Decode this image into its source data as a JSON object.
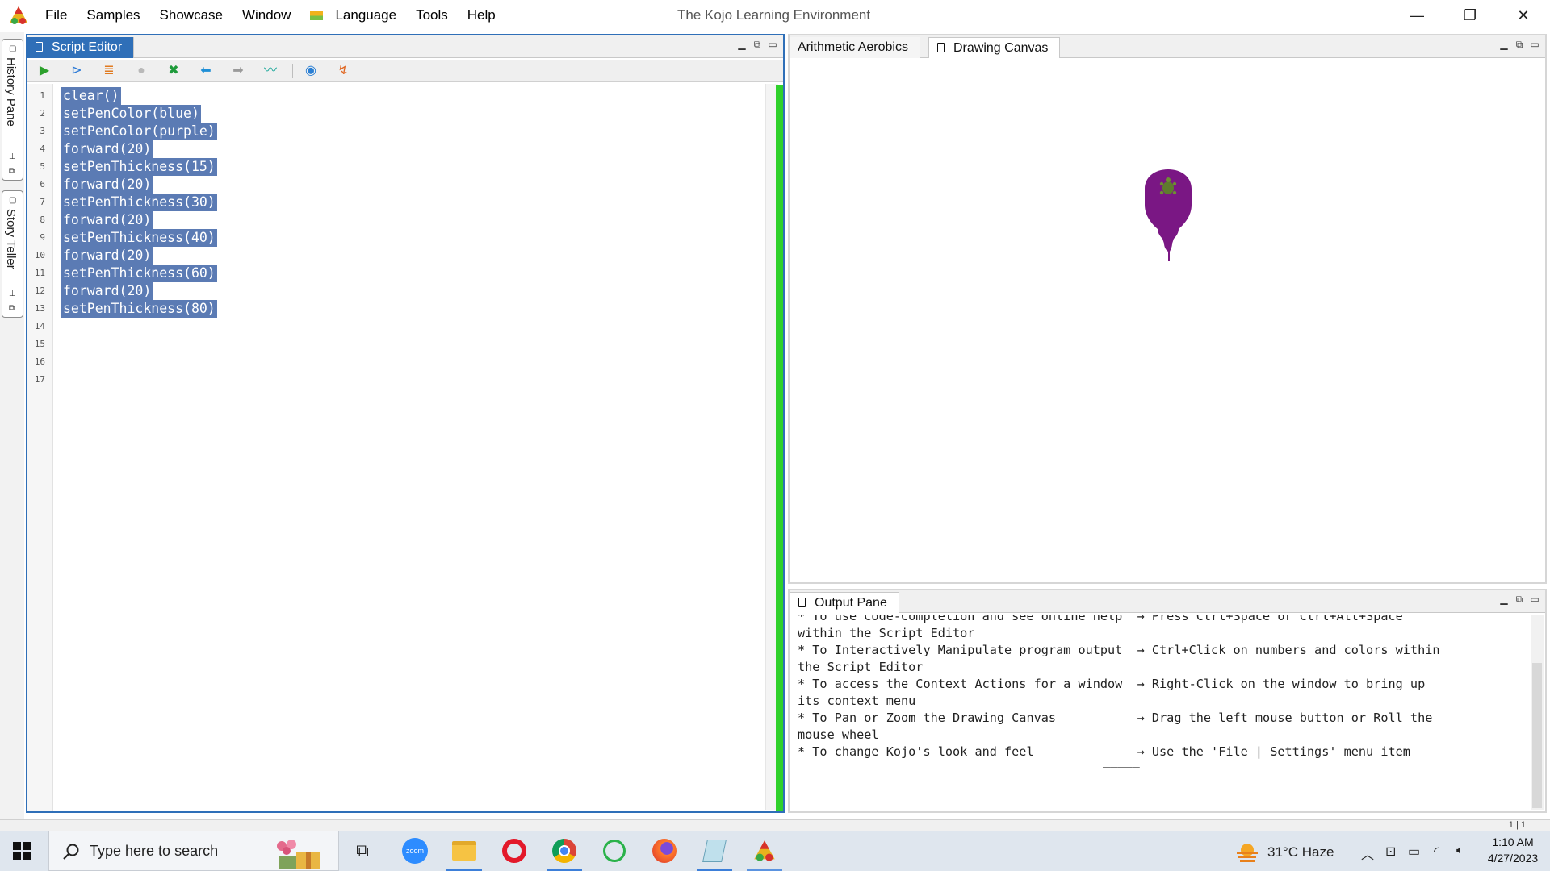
{
  "titlebar": {
    "app_title": "The Kojo Learning Environment",
    "menu": [
      "File",
      "Samples",
      "Showcase",
      "Window",
      "Language",
      "Tools",
      "Help"
    ],
    "controls": {
      "minimize": "—",
      "restore": "❐",
      "close": "✕"
    }
  },
  "side_tabs": [
    {
      "label": "History Pane"
    },
    {
      "label": "Story Teller"
    }
  ],
  "script_editor": {
    "tab_label": "Script Editor",
    "toolbar_icons": [
      "run-icon",
      "step-icon",
      "trace-icon",
      "stop-icon",
      "clear-icon",
      "undo-icon",
      "redo-icon",
      "format-icon",
      "help-icon",
      "reset-icon"
    ],
    "line_numbers": [
      "1",
      "2",
      "3",
      "4",
      "5",
      "6",
      "7",
      "8",
      "9",
      "10",
      "11",
      "12",
      "13",
      "14",
      "15",
      "16",
      "17"
    ],
    "code_lines": [
      "clear()",
      "setPenColor(blue)",
      "setPenColor(purple)",
      "forward(20)",
      "setPenThickness(15)",
      "forward(20)",
      "setPenThickness(30)",
      "forward(20)",
      "setPenThickness(40)",
      "forward(20)",
      "setPenThickness(60)",
      "forward(20)",
      "setPenThickness(80)"
    ],
    "selection_color": "#5b7bb4"
  },
  "canvas": {
    "tabs": [
      "Arithmetic Aerobics",
      "Drawing Canvas"
    ],
    "selected_tab": "Drawing Canvas",
    "drawing_color": "#7a1784"
  },
  "output_pane": {
    "tab_label": "Output Pane",
    "lines": [
      "* To use Code-Completion and see online help  → Press Ctrl+Space or Ctrl+Alt+Space",
      "within the Script Editor",
      "* To Interactively Manipulate program output  → Ctrl+Click on numbers and colors within",
      "the Script Editor",
      "* To access the Context Actions for a window  → Right-Click on the window to bring up",
      "its context menu",
      "* To Pan or Zoom the Drawing Canvas           → Drag the left mouse button or Roll the",
      "mouse wheel",
      "* To change Kojo's look and feel              → Use the 'File | Settings' menu item"
    ],
    "separator": "_____"
  },
  "status": {
    "position": "1 | 1"
  },
  "taskbar": {
    "search_placeholder": "Type here to search",
    "apps": [
      "task-view-icon",
      "zoom-icon",
      "file-explorer-icon",
      "opera-icon",
      "chrome-icon",
      "whatsapp-icon",
      "firefox-icon",
      "notepad-icon",
      "kojo-icon"
    ],
    "zoom_label": "zoom",
    "weather": "31°C  Haze",
    "time": "1:10 AM",
    "date": "4/27/2023"
  }
}
